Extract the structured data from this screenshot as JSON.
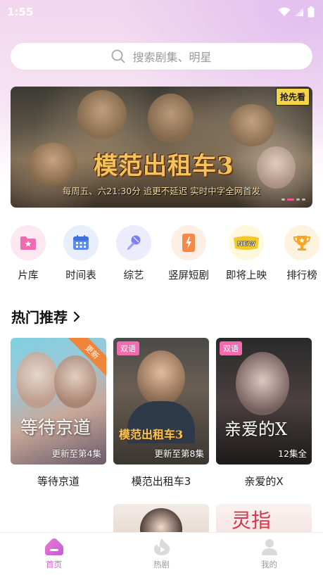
{
  "status_bar": {
    "time": "1:55"
  },
  "search": {
    "placeholder": "搜索剧集、明星"
  },
  "banner": {
    "title": "模范出租车3",
    "subtitle": "每周五、六21:30分 追更不延迟 实时中字全网首发",
    "badge": "抢先看",
    "pages": 4,
    "active_page": 2
  },
  "categories": [
    {
      "label": "片库",
      "icon": "film-library-icon",
      "color": "#f06cb0",
      "bg": "#fde8f1"
    },
    {
      "label": "时间表",
      "icon": "calendar-icon",
      "color": "#5a8cf0",
      "bg": "#e8eefc"
    },
    {
      "label": "综艺",
      "icon": "microphone-icon",
      "color": "#7b7ef0",
      "bg": "#ececfd"
    },
    {
      "label": "竖屏短剧",
      "icon": "lightning-phone-icon",
      "color": "#f5894a",
      "bg": "#feefe4"
    },
    {
      "label": "即将上映",
      "icon": "new-badge-icon",
      "color": "#f5c928",
      "bg": "#fff8dd"
    },
    {
      "label": "排行榜",
      "icon": "trophy-icon",
      "color": "#f5a623",
      "bg": "#fff3df"
    }
  ],
  "section": {
    "title": "热门推荐"
  },
  "cards": [
    {
      "name": "等待京道",
      "episodes": "更新至第4集",
      "poster_title": "等待京道",
      "ribbon": "更新",
      "tag": ""
    },
    {
      "name": "模范出租车3",
      "episodes": "更新至第8集",
      "poster_title": "模范出租车3",
      "ribbon": "",
      "tag": "双语"
    },
    {
      "name": "亲爱的X",
      "episodes": "12集全",
      "poster_title": "亲爱的X",
      "ribbon": "",
      "tag": "双语"
    }
  ],
  "row2_cards": [
    {
      "poster_title": ""
    },
    {
      "poster_title": "灵指"
    }
  ],
  "tabbar": {
    "items": [
      {
        "label": "首页",
        "icon": "home-icon",
        "active": true
      },
      {
        "label": "热剧",
        "icon": "flame-icon",
        "active": false
      },
      {
        "label": "我的",
        "icon": "profile-icon",
        "active": false
      }
    ]
  },
  "colors": {
    "accent": "#d65dcb",
    "inactive": "#9a9a9a"
  }
}
